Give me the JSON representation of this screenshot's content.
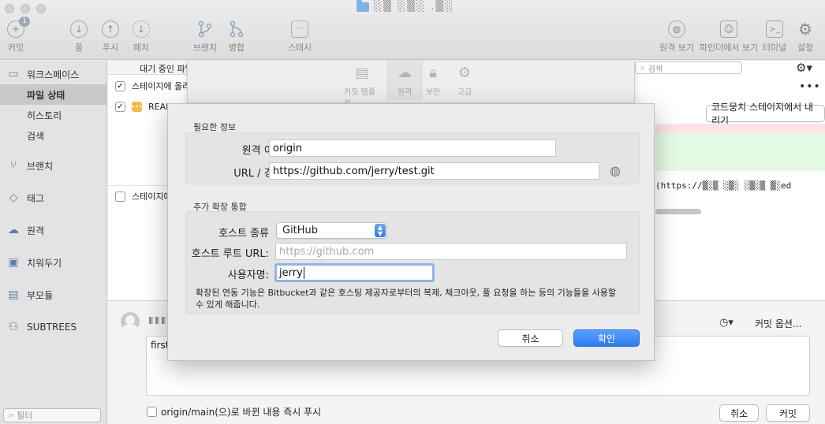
{
  "window": {
    "title": "░▒ ░▒░ .▒░"
  },
  "toolbar": {
    "left": [
      {
        "name": "commit",
        "label": "커밋",
        "icon": "plus-icon",
        "badge": "1"
      },
      {
        "name": "pull",
        "label": "풀",
        "icon": "arrow-down-icon"
      },
      {
        "name": "push",
        "label": "푸시",
        "icon": "arrow-up-icon"
      },
      {
        "name": "fetch",
        "label": "페치",
        "icon": "fetch-icon"
      },
      {
        "name": "branch",
        "label": "브랜치",
        "icon": "branch-icon"
      },
      {
        "name": "merge",
        "label": "병합",
        "icon": "merge-icon"
      },
      {
        "name": "stash",
        "label": "스태시",
        "icon": "stash-icon"
      }
    ],
    "right": [
      {
        "name": "remote-view",
        "label": "원격 보기",
        "icon": "globe-icon"
      },
      {
        "name": "finder-view",
        "label": "파인더에서 보기",
        "icon": "finder-icon"
      },
      {
        "name": "terminal",
        "label": "터미널",
        "icon": "terminal-icon"
      },
      {
        "name": "settings",
        "label": "설정",
        "icon": "gear-icon"
      }
    ]
  },
  "sidebar": {
    "workspace": "워크스페이스",
    "file_status": "파일 상태",
    "history": "히스토리",
    "search": "검색",
    "branches": "브랜치",
    "tags": "태그",
    "remotes": "원격",
    "stashes": "치워두기",
    "submodules": "부모듈",
    "subtrees": "SUBTREES",
    "filter_placeholder": "필터"
  },
  "main": {
    "list_header": "대기 중인 파일",
    "row1": "스테이지에 올라간 파일",
    "row2": "README",
    "row3": "스테이지에 올라가지 않은 파일",
    "search_placeholder": "검색",
    "unstage_button": "코드뭉치 스테이지에서 내리기",
    "diff_line": "(https://▒░▒ ░▒░ ░▒░▒ ▒░ed",
    "commit_message": "first",
    "commit_options": "커밋 옵션...",
    "push_label": "origin/main(으)로 바뀐 내용 즉시 푸시",
    "cancel": "취소",
    "commit": "커밋"
  },
  "settings_tabs": [
    {
      "label": "커밋 템플릿",
      "icon": "document-icon"
    },
    {
      "label": "원격",
      "icon": "cloud-icon",
      "active": true
    },
    {
      "label": "보안",
      "icon": "lock-icon"
    },
    {
      "label": "고급",
      "icon": "gear-icon"
    }
  ],
  "dialog": {
    "section1_title": "필요한 정보",
    "remote_name_label": "원격 이름:",
    "remote_name_value": "origin",
    "url_label": "URL / 경로:",
    "url_value": "https://github.com/jerry/test.git",
    "section2_title": "추가 확장 통합",
    "host_type_label": "호스트 종류",
    "host_type_value": "GitHub",
    "host_root_label": "호스트 루트 URL:",
    "host_root_placeholder": "https://github.com",
    "username_label": "사용자명:",
    "username_value": "jerry",
    "description": "확장된 연동 기능은 Bitbucket과 같은 호스팅 제공자로부터의 복제, 체크아웃, 풀 요청을 하는 등의 기능들을 사용할 수 있게 해줍니다.",
    "cancel_label": "취소",
    "ok_label": "확인"
  },
  "colors": {
    "accent": "#2f7ae8",
    "focus_ring": "#8fb3e9",
    "diff_added": "#e3fbe3",
    "diff_removed": "#fde3e3"
  }
}
